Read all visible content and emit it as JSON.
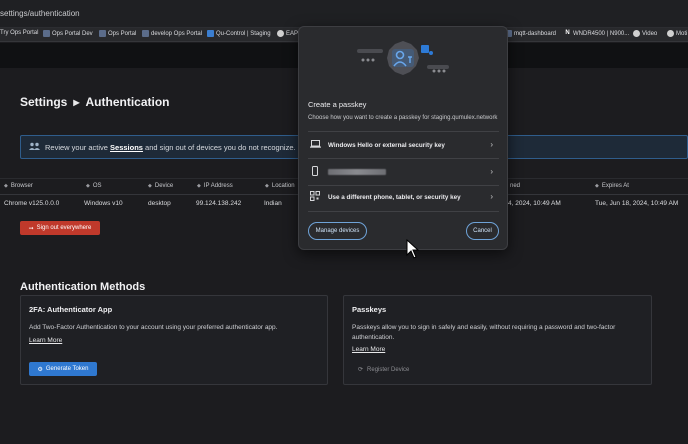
{
  "browser": {
    "url": "settings/authentication",
    "bookmarks": [
      {
        "label": "Try Ops Portal",
        "icon": "none"
      },
      {
        "label": "Ops Portal Dev",
        "icon": "portal-icon"
      },
      {
        "label": "Ops Portal",
        "icon": "portal-icon"
      },
      {
        "label": "develop Ops Portal",
        "icon": "portal-icon"
      },
      {
        "label": "Qu-Control | Staging",
        "icon": "qu-icon"
      },
      {
        "label": "EAP",
        "icon": "github-icon"
      },
      {
        "label": "mqtt-dashboard",
        "icon": "portal-icon"
      },
      {
        "label": "WNDR4500 | N900...",
        "icon": "netgear-icon"
      },
      {
        "label": "Video",
        "icon": "globe-icon"
      },
      {
        "label": "Moti",
        "icon": "globe-icon"
      }
    ]
  },
  "page": {
    "breadcrumb": {
      "parent": "Settings",
      "current": "Authentication"
    },
    "banner": {
      "prefix": "Review your active ",
      "link": "Sessions",
      "suffix": " and sign out of devices you do not recognize."
    },
    "sessions_table": {
      "columns": [
        "Browser",
        "OS",
        "Device",
        "IP Address",
        "Location",
        "ned",
        "Expires At"
      ],
      "rows": [
        {
          "browser": "Chrome v125.0.0.0",
          "os": "Windows v10",
          "device": "desktop",
          "ip": "99.124.138.242",
          "location": "Indian",
          "signed_in": "4, 2024, 10:49 AM",
          "expires": "Tue, Jun 18, 2024, 10:49 AM"
        }
      ]
    },
    "sign_out_label": "Sign out everywhere",
    "auth_methods": {
      "title": "Authentication Methods",
      "authenticator": {
        "title": "2FA: Authenticator App",
        "description": "Add Two-Factor Authentication to your account using your preferred authenticator app.",
        "learn_more": "Learn More",
        "button": "Generate Token"
      },
      "passkeys": {
        "title": "Passkeys",
        "description": "Passkeys allow you to sign in safely and easily, without requiring a password and two-factor authentication.",
        "learn_more": "Learn More",
        "button": "Register Device"
      }
    }
  },
  "dialog": {
    "title": "Create a passkey",
    "subtitle": "Choose how you want to create a passkey for staging.qumulex.network",
    "options": [
      {
        "label": "Windows Hello or external security key",
        "icon": "laptop-icon"
      },
      {
        "label": "",
        "icon": "phone-icon"
      },
      {
        "label": "Use a different phone, tablet, or security key",
        "icon": "qr-code-icon"
      }
    ],
    "manage_label": "Manage devices",
    "cancel_label": "Cancel"
  },
  "colors": {
    "accent": "#2f78d0",
    "danger": "#c0392b",
    "dialog_bg": "#2a2b2e",
    "background": "#1c1c1f"
  }
}
